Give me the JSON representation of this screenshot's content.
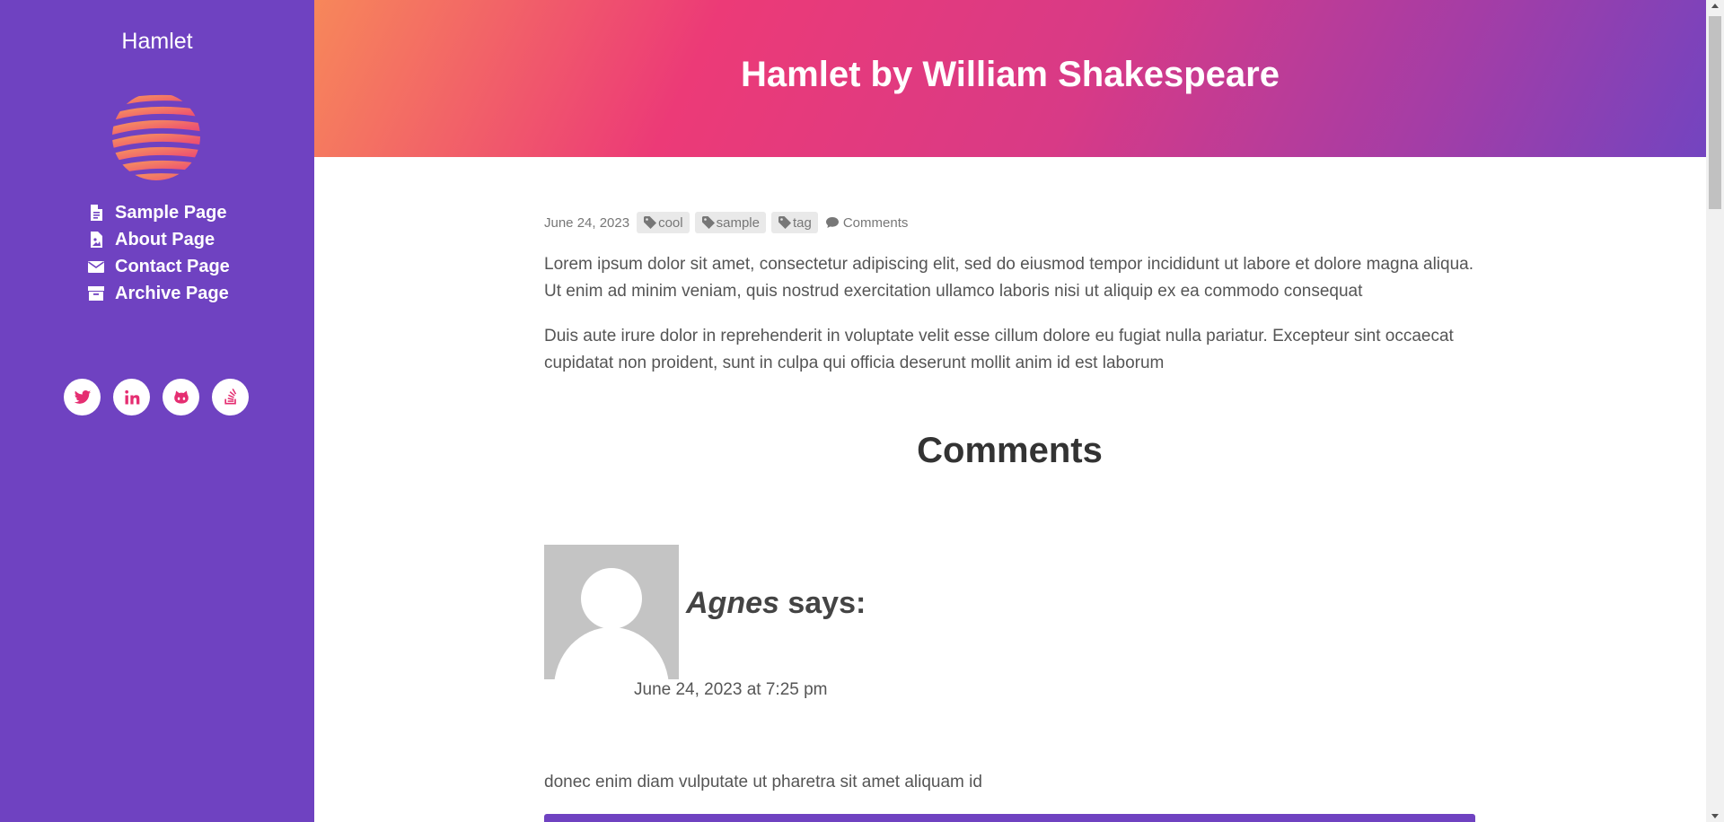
{
  "sidebar": {
    "title": "Hamlet",
    "logo_icon": "striped-globe-logo",
    "nav": [
      {
        "label": "Sample Page",
        "icon": "file-text-icon"
      },
      {
        "label": "About Page",
        "icon": "file-image-icon"
      },
      {
        "label": "Contact Page",
        "icon": "envelope-icon"
      },
      {
        "label": "Archive Page",
        "icon": "archive-box-icon"
      }
    ],
    "social": [
      {
        "icon": "twitter-icon"
      },
      {
        "icon": "linkedin-icon"
      },
      {
        "icon": "github-icon"
      },
      {
        "icon": "stack-overflow-icon"
      }
    ]
  },
  "header": {
    "title": "Hamlet by William Shakespeare"
  },
  "post": {
    "date": "June 24, 2023",
    "tags": [
      "cool",
      "sample",
      "tag"
    ],
    "comments_link": "Comments",
    "paragraphs": [
      "Lorem ipsum dolor sit amet, consectetur adipiscing elit, sed do eiusmod tempor incididunt ut labore et dolore magna aliqua. Ut enim ad minim veniam, quis nostrud exercitation ullamco laboris nisi ut aliquip ex ea commodo consequat",
      "Duis aute irure dolor in reprehenderit in voluptate velit esse cillum dolore eu fugiat nulla pariatur. Excepteur sint occaecat cupidatat non proident, sunt in culpa qui officia deserunt mollit anim id est laborum"
    ]
  },
  "comments": {
    "heading": "Comments",
    "items": [
      {
        "author": "Agnes",
        "says": " says:",
        "date": "June 24, 2023 at 7:25 pm",
        "text": "donec enim diam vulputate ut pharetra sit amet aliquam id"
      }
    ]
  },
  "colors": {
    "sidebar_bg": "#6f42c1",
    "accent_pink": "#e52e71",
    "hero_gradient_start": "#f7875a",
    "hero_gradient_mid": "#ec3a77",
    "hero_gradient_end": "#7344c0"
  }
}
